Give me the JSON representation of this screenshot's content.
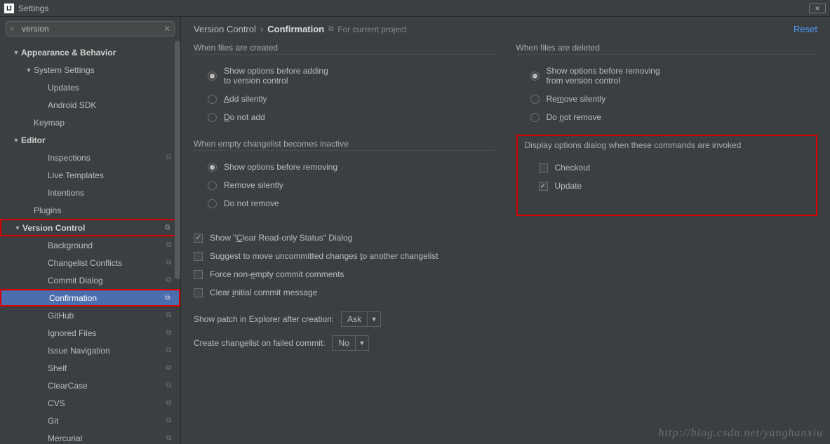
{
  "window": {
    "title": "Settings"
  },
  "search": {
    "value": "version"
  },
  "reset": "Reset",
  "breadcrumb": {
    "a": "Version Control",
    "b": "Confirmation",
    "scope": "For current project"
  },
  "sidebar": {
    "items": [
      {
        "label": "Appearance & Behavior",
        "depth": 0,
        "arrow": "▼"
      },
      {
        "label": "System Settings",
        "depth": 1,
        "arrow": "▼"
      },
      {
        "label": "Updates",
        "depth": 2
      },
      {
        "label": "Android SDK",
        "depth": 2
      },
      {
        "label": "Keymap",
        "depth": 1
      },
      {
        "label": "Editor",
        "depth": 0,
        "arrow": "▼"
      },
      {
        "label": "Inspections",
        "depth": 2,
        "copy": true
      },
      {
        "label": "Live Templates",
        "depth": 2
      },
      {
        "label": "Intentions",
        "depth": 2
      },
      {
        "label": "Plugins",
        "depth": 1
      },
      {
        "label": "Version Control",
        "depth": 0,
        "arrow": "▼",
        "copy": true,
        "redbox": true
      },
      {
        "label": "Background",
        "depth": 2,
        "copy": true
      },
      {
        "label": "Changelist Conflicts",
        "depth": 2,
        "copy": true
      },
      {
        "label": "Commit Dialog",
        "depth": 2,
        "copy": true
      },
      {
        "label": "Confirmation",
        "depth": 2,
        "copy": true,
        "selected": true,
        "redbox": true
      },
      {
        "label": "GitHub",
        "depth": 2,
        "copy": true
      },
      {
        "label": "Ignored Files",
        "depth": 2,
        "copy": true
      },
      {
        "label": "Issue Navigation",
        "depth": 2,
        "copy": true
      },
      {
        "label": "Shelf",
        "depth": 2,
        "copy": true
      },
      {
        "label": "ClearCase",
        "depth": 2,
        "copy": true
      },
      {
        "label": "CVS",
        "depth": 2,
        "copy": true
      },
      {
        "label": "Git",
        "depth": 2,
        "copy": true
      },
      {
        "label": "Mercurial",
        "depth": 2,
        "copy": true
      }
    ]
  },
  "groups": {
    "created": {
      "title": "When files are created",
      "opts": [
        "Show options before adding to version control",
        "Add silently",
        "Do not add"
      ],
      "selected": 0
    },
    "deleted": {
      "title": "When files are deleted",
      "opts": [
        "Show options before removing from version control",
        "Remove silently",
        "Do not remove"
      ],
      "selected": 0
    },
    "empty": {
      "title": "When empty changelist becomes inactive",
      "opts": [
        "Show options before removing",
        "Remove silently",
        "Do not remove"
      ],
      "selected": 0
    },
    "display": {
      "title": "Display options dialog when these commands are invoked",
      "opts": [
        {
          "label": "Checkout",
          "checked": false
        },
        {
          "label": "Update",
          "checked": true
        }
      ]
    }
  },
  "checks": [
    {
      "label": "Show \"Clear Read-only Status\" Dialog",
      "checked": true
    },
    {
      "label": "Suggest to move uncommitted changes to another changelist",
      "checked": false
    },
    {
      "label": "Force non-empty commit comments",
      "checked": false
    },
    {
      "label": "Clear initial commit message",
      "checked": false
    }
  ],
  "combos": {
    "patch": {
      "label": "Show patch in Explorer after creation:",
      "value": "Ask"
    },
    "failed": {
      "label": "Create changelist on failed commit:",
      "value": "No"
    }
  },
  "watermark": "http://blog.csdn.net/yanghanxiu"
}
